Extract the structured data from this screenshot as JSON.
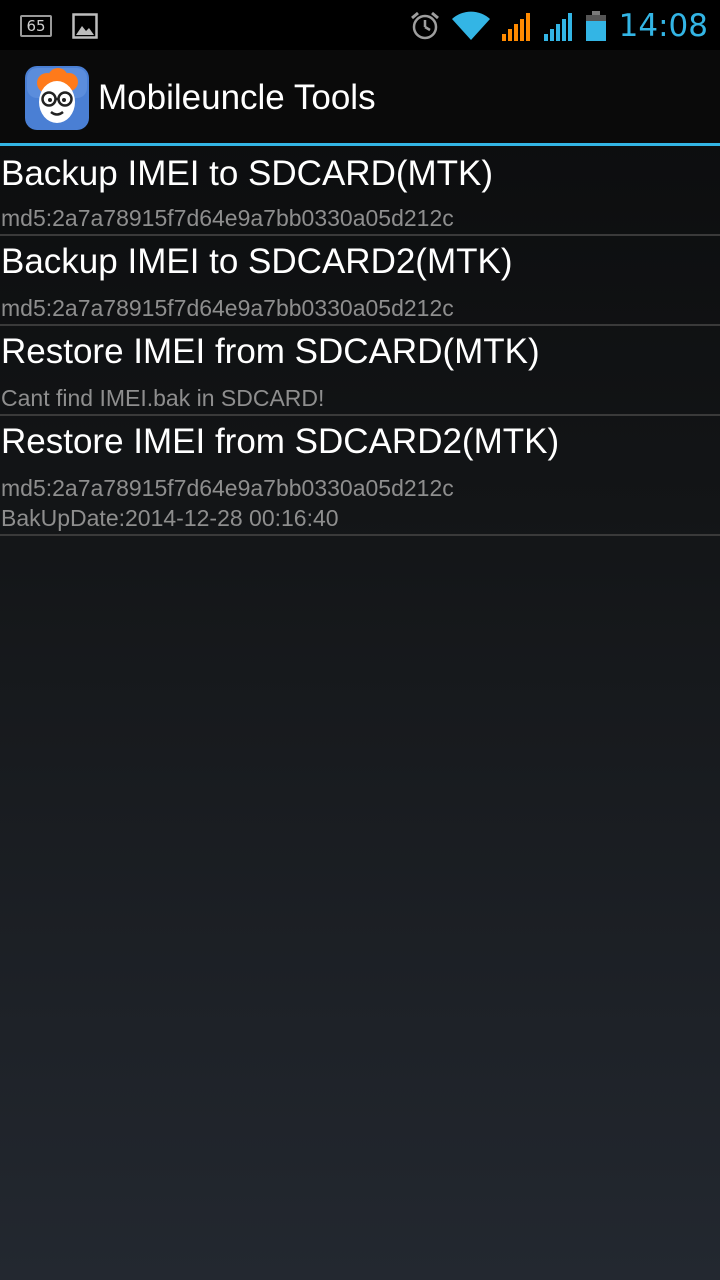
{
  "status_bar": {
    "notification_count": "65",
    "icons": [
      "notification-count-icon",
      "image-icon",
      "alarm-icon",
      "wifi-icon",
      "signal-orange-icon",
      "signal-blue-icon",
      "battery-icon"
    ],
    "time": "14:08",
    "accent": "#33b5e5"
  },
  "action_bar": {
    "title": "Mobileuncle Tools",
    "icon": "mobileuncle-logo-icon"
  },
  "list": {
    "items": [
      {
        "title": "Backup IMEI to SDCARD(MTK)",
        "lines": [
          "md5:2a7a78915f7d64e9a7bb0330a05d212c"
        ]
      },
      {
        "title": "Backup IMEI to SDCARD2(MTK)",
        "lines": [
          "md5:2a7a78915f7d64e9a7bb0330a05d212c"
        ]
      },
      {
        "title": "Restore IMEI from SDCARD(MTK)",
        "lines": [
          "Cant find IMEI.bak in SDCARD!"
        ]
      },
      {
        "title": "Restore IMEI from SDCARD2(MTK)",
        "lines": [
          "md5:2a7a78915f7d64e9a7bb0330a05d212c",
          "BakUpDate:2014-12-28 00:16:40"
        ]
      }
    ]
  }
}
